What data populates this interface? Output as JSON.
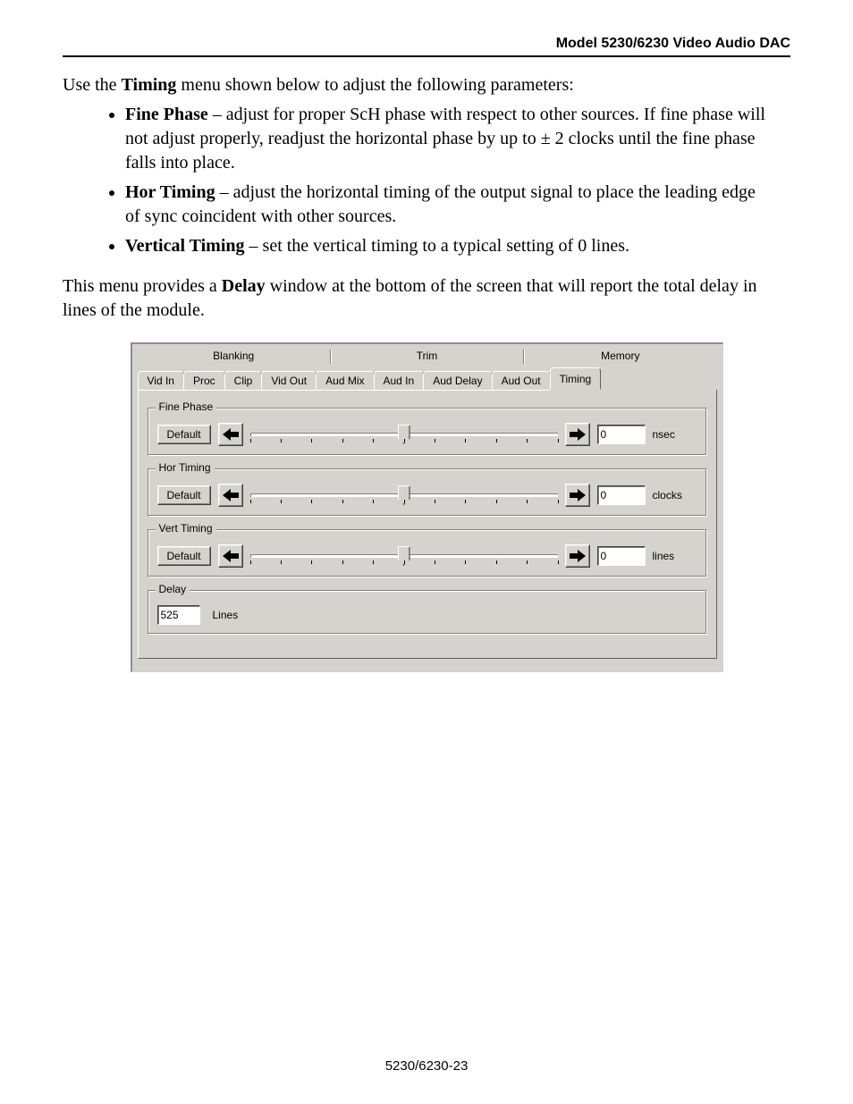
{
  "header": {
    "title": "Model 5230/6230 Video Audio DAC"
  },
  "intro": {
    "pre": "Use the ",
    "bold": "Timing",
    "post": " menu shown below to adjust the following parameters:"
  },
  "bullets": [
    {
      "name": "Fine Phase",
      "text": " – adjust for proper ScH phase with respect to other sources. If fine phase will not adjust properly, readjust the horizontal phase by up to ± 2 clocks until the fine phase falls into place."
    },
    {
      "name": "Hor Timing",
      "text": " – adjust the horizontal timing of the output signal to place the leading edge of sync coincident with other sources."
    },
    {
      "name": "Vertical Timing",
      "text": " – set the vertical timing to a typical setting of 0 lines."
    }
  ],
  "para2": {
    "pre": "This menu provides a ",
    "bold": "Delay",
    "post": " window at the bottom of the screen that will report the total delay in lines of the module."
  },
  "panel": {
    "categories": [
      "Blanking",
      "Trim",
      "Memory"
    ],
    "tabs": [
      "Vid In",
      "Proc",
      "Clip",
      "Vid Out",
      "Aud Mix",
      "Aud In",
      "Aud Delay",
      "Aud Out",
      "Timing"
    ],
    "active_tab_index": 8,
    "sliders": [
      {
        "title": "Fine Phase",
        "default_label": "Default",
        "value": "0",
        "unit": "nsec"
      },
      {
        "title": "Hor Timing",
        "default_label": "Default",
        "value": "0",
        "unit": "clocks"
      },
      {
        "title": "Vert Timing",
        "default_label": "Default",
        "value": "0",
        "unit": "lines"
      }
    ],
    "delay": {
      "title": "Delay",
      "value": "525",
      "unit": "Lines"
    }
  },
  "footer": {
    "text": "5230/6230-23"
  }
}
